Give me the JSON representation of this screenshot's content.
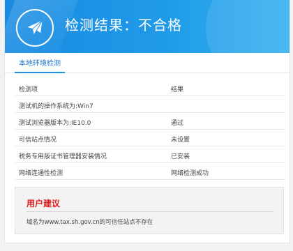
{
  "header": {
    "title": "检测结果：不合格",
    "icon": "plane-icon",
    "accent": "#1a8be2"
  },
  "tabs": [
    {
      "label": "本地环境检测",
      "active": true
    }
  ],
  "table": {
    "headers": [
      "检测项",
      "结果"
    ],
    "rows": [
      [
        "测试机的操作系统为:Win7",
        ""
      ],
      [
        "测试浏览器版本为:IE10.0",
        "通过"
      ],
      [
        "可信站点情况",
        "未设置"
      ],
      [
        "税务专用版证书管理器安装情况",
        "已安装"
      ],
      [
        "网络连通性检测",
        "网络检测成功"
      ]
    ]
  },
  "advice": {
    "title": "用户建议",
    "title_color": "#e02020",
    "text": "域名为www.tax.sh.gov.cn的可信任站点不存在"
  }
}
